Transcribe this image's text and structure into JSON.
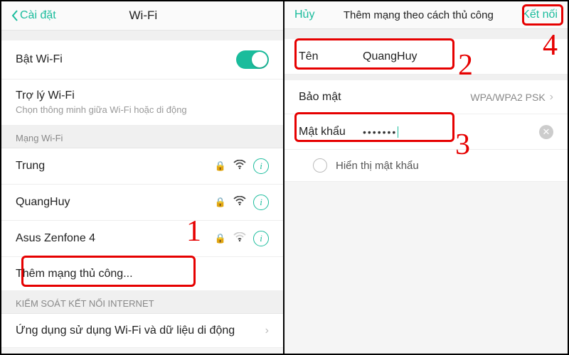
{
  "left": {
    "back": "Cài đặt",
    "title": "Wi-Fi",
    "wifi_toggle_label": "Bật Wi-Fi",
    "assistant_label": "Trợ lý Wi-Fi",
    "assistant_sub": "Chọn thông minh giữa Wi-Fi hoặc di động",
    "section_networks": "Mạng Wi-Fi",
    "networks": [
      {
        "name": "Trung",
        "locked": true,
        "strength": "strong"
      },
      {
        "name": "QuangHuy",
        "locked": true,
        "strength": "strong"
      },
      {
        "name": "Asus Zenfone 4",
        "locked": true,
        "strength": "weak"
      }
    ],
    "add_manual": "Thêm mạng thủ công...",
    "section_internet": "KIỂM SOÁT KẾT NỐI INTERNET",
    "app_data_row": "Ứng dụng sử dụng Wi-Fi và dữ liệu di động"
  },
  "right": {
    "cancel": "Hủy",
    "title": "Thêm mạng theo cách thủ công",
    "connect": "Kết nối",
    "name_label": "Tên",
    "name_value": "QuangHuy",
    "security_label": "Bảo mật",
    "security_value": "WPA/WPA2 PSK",
    "password_label": "Mật khẩu",
    "password_value": "•••••••",
    "show_password": "Hiển thị mật khẩu"
  },
  "annotations": {
    "n1": "1",
    "n2": "2",
    "n3": "3",
    "n4": "4"
  }
}
